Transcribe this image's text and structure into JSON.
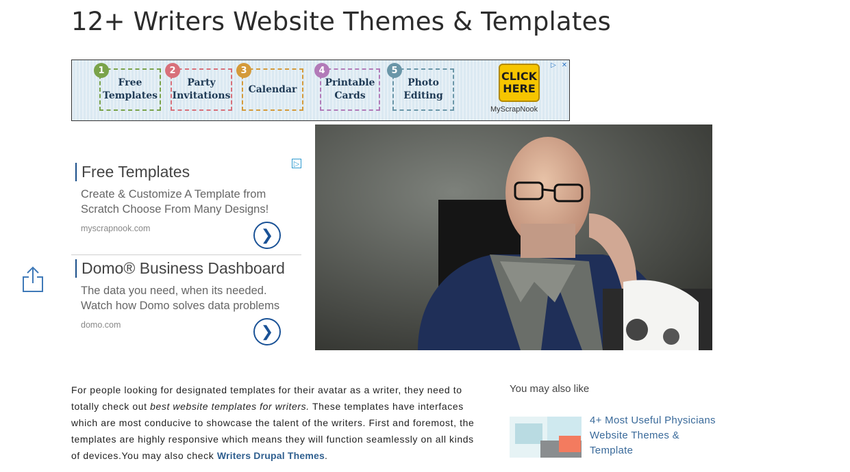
{
  "page": {
    "title": "12+ Writers Website Themes & Templates"
  },
  "banner": {
    "steps": [
      {
        "num": "1",
        "label_line1": "Free",
        "label_line2": "Templates",
        "color": "#7aa34a"
      },
      {
        "num": "2",
        "label_line1": "Party",
        "label_line2": "Invitations",
        "color": "#d8707a"
      },
      {
        "num": "3",
        "label_line1": "Calendar",
        "label_line2": "",
        "color": "#d49a3a"
      },
      {
        "num": "4",
        "label_line1": "Printable",
        "label_line2": "Cards",
        "color": "#b27ab8"
      },
      {
        "num": "5",
        "label_line1": "Photo",
        "label_line2": "Editing",
        "color": "#6a96a8"
      }
    ],
    "cta_line1": "CLICK",
    "cta_line2": "HERE",
    "brand": "MyScrapNook",
    "adchoices_icon": "play-triangle-icon",
    "close_icon": "close-icon"
  },
  "side_ads": [
    {
      "title": "Free Templates",
      "desc": "Create & Customize A Template from Scratch Choose From Many Designs!",
      "url": "myscrapnook.com",
      "arrow_icon": "chevron-right-icon"
    },
    {
      "title": "Domo® Business Dashboard",
      "desc": "The data you need, when its needed. Watch how Domo solves data problems",
      "url": "domo.com",
      "arrow_icon": "chevron-right-icon"
    }
  ],
  "article": {
    "text_before": "For people looking for designated templates for their avatar as a writer, they need to totally check out ",
    "emphasis": "best website templates for writers.",
    "text_after": " These templates have interfaces which are most conducive to showcase the talent of the writers. First and foremost, the templates are highly responsive which means they will function seamlessly on all kinds of devices.You may also check ",
    "link": "Writers Drupal Themes",
    "end": "."
  },
  "related": {
    "heading": "You may also like",
    "item_title": "4+ Most Useful Physicians Website Themes & Template"
  },
  "share": {
    "icon": "share-icon"
  }
}
